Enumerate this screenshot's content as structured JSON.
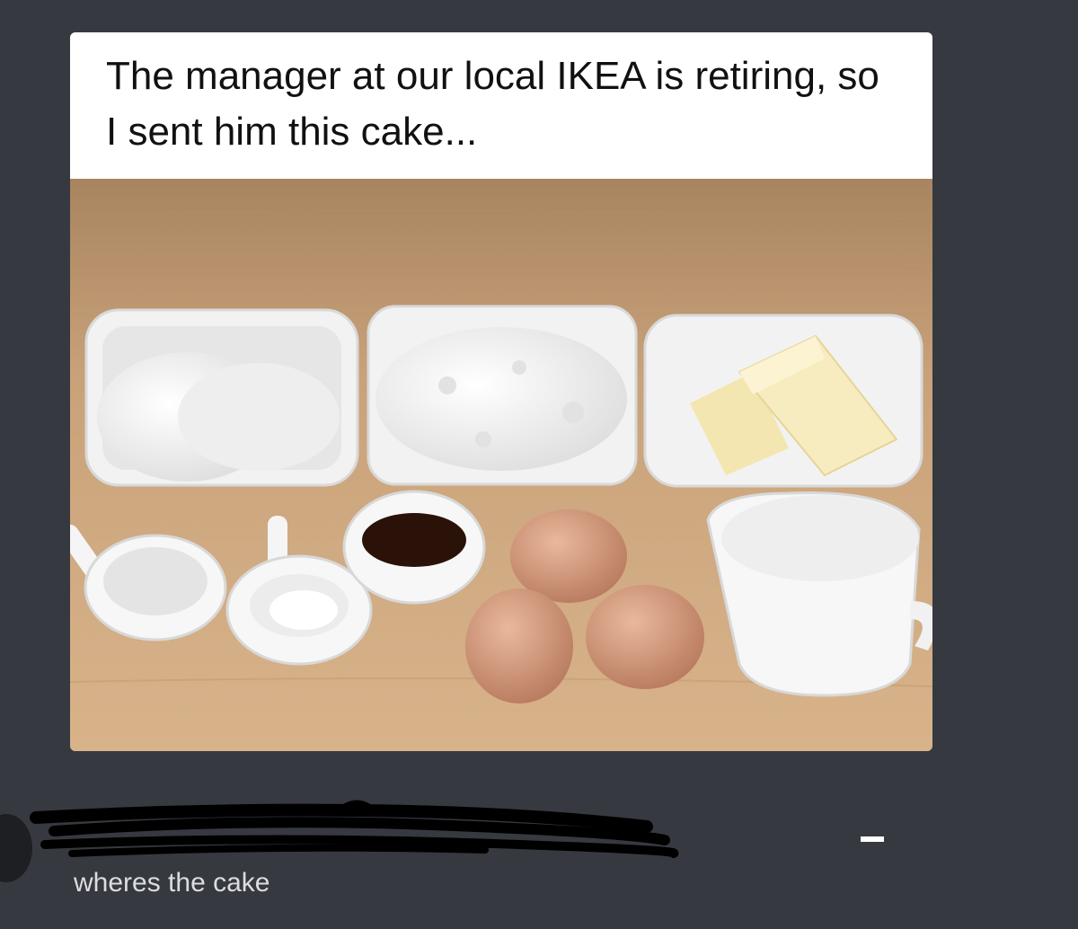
{
  "post": {
    "caption": "The manager at our local IKEA is retiring, so I sent him this cake...",
    "image_subject": "baking ingredients"
  },
  "reply": {
    "author": "",
    "message": "wheres the cake"
  },
  "colors": {
    "background": "#36393f",
    "reply_text": "#dcddde",
    "caption_bg": "#ffffff"
  }
}
